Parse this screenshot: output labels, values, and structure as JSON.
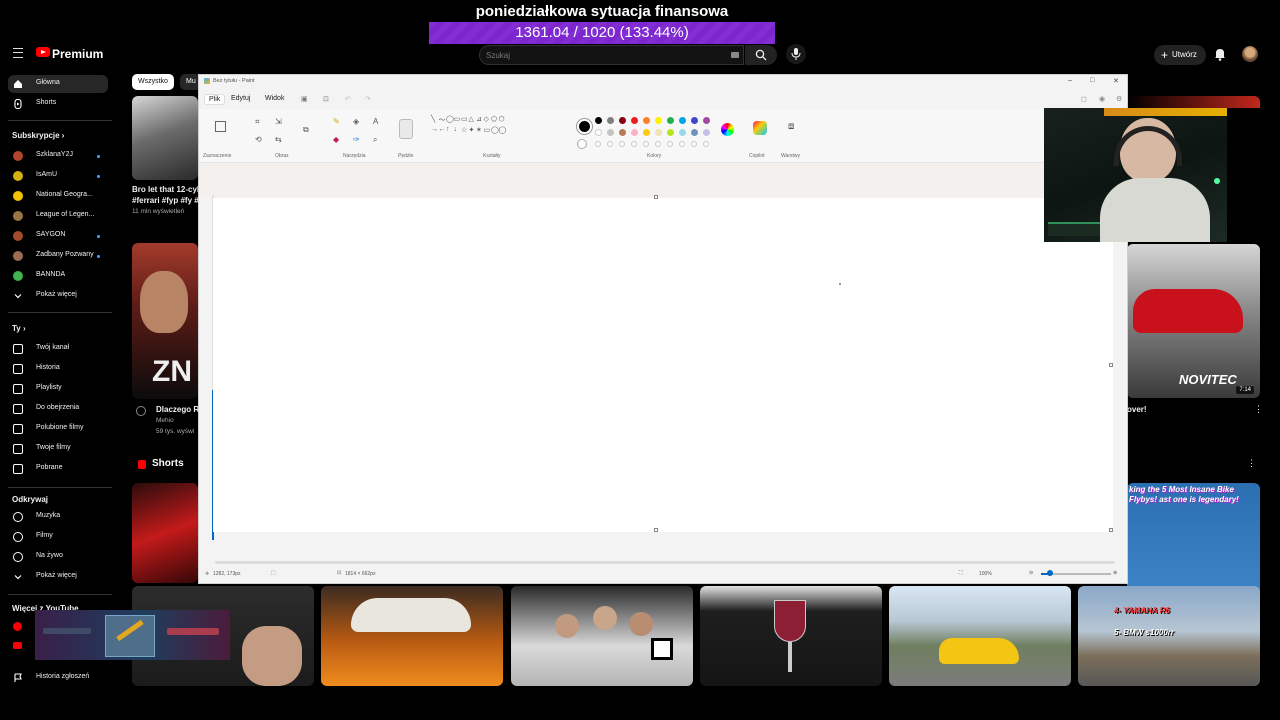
{
  "stream": {
    "title": "poniedziałkowa sytuacja finansowa",
    "progress_text": "1361.04 / 1020 (133.44%)",
    "progress_fraction": 1.0,
    "accent": "#8b2be2"
  },
  "youtube": {
    "brand": "Premium",
    "search_placeholder": "Szukaj",
    "create_label": "Utwórz",
    "chips": [
      "Wszystko",
      "Mu"
    ],
    "sidebar": {
      "main": [
        {
          "label": "Główna",
          "icon": "home-icon"
        },
        {
          "label": "Shorts",
          "icon": "shorts-icon"
        }
      ],
      "subs_header": "Subskrypcje",
      "subs": [
        {
          "label": "SzklanaY2J",
          "color": "#b0462d"
        },
        {
          "label": "IsAmU",
          "color": "#d4b012"
        },
        {
          "label": "National Geogra...",
          "color": "#f2c200"
        },
        {
          "label": "League of Legen...",
          "color": "#9a7740"
        },
        {
          "label": "SAYGON",
          "color": "#a34b2c"
        },
        {
          "label": "Zadbany Pozwany",
          "color": "#9c6b52"
        },
        {
          "label": "BANNDA",
          "color": "#3fb34f"
        }
      ],
      "show_more": "Pokaż więcej",
      "you_header": "Ty",
      "you": [
        {
          "label": "Twój kanał",
          "icon": "channel-icon"
        },
        {
          "label": "Historia",
          "icon": "history-icon"
        },
        {
          "label": "Playlisty",
          "icon": "playlist-icon"
        },
        {
          "label": "Do obejrzenia",
          "icon": "clock-icon"
        },
        {
          "label": "Polubione filmy",
          "icon": "like-icon"
        },
        {
          "label": "Twoje filmy",
          "icon": "video-icon"
        },
        {
          "label": "Pobrane",
          "icon": "download-icon"
        }
      ],
      "explore_header": "Odkrywaj",
      "explore": [
        {
          "label": "Muzyka",
          "icon": "music-icon"
        },
        {
          "label": "Filmy",
          "icon": "film-icon"
        },
        {
          "label": "Na żywo",
          "icon": "live-icon"
        }
      ],
      "show_more_2": "Pokaż więcej",
      "more_header": "Więcej z YouTube",
      "report": "Historia zgłoszeń"
    },
    "videos": [
      {
        "title": "Bro let that 12-cyli",
        "title2": "#ferrari #fyp #fy #",
        "meta": "11 mln wyświetleń"
      },
      {
        "title": "Dlaczego Ri",
        "channel": "Mehio",
        "meta": "59 tys. wyświ"
      },
      {
        "title": "over!"
      }
    ],
    "shorts_header": "Shorts",
    "right_thumb_text": "NOVITEC",
    "right_thumb_time": "7:14",
    "right_short_text": "king the 5 Most Insane Bike Flybys! ast one is legendary!",
    "bottom_short": {
      "line1": "4- YAMAHA R6",
      "line2": "5- BMW s1000rr"
    },
    "thumb_badge": "ZN"
  },
  "paint": {
    "window_title": "Bez tytułu - Paint",
    "menu": [
      "Plik",
      "Edytuj",
      "Widok"
    ],
    "groups": [
      "Zaznaczenie",
      "Obraz",
      "Narzędzia",
      "Pędzle",
      "Kształty",
      "Kolory",
      "Copilot",
      "Warstwy"
    ],
    "colors_row1": [
      "#000000",
      "#7f7f7f",
      "#880015",
      "#ed1c24",
      "#ff7f27",
      "#fff200",
      "#22b14c",
      "#00a2e8",
      "#3f48cc",
      "#a349a4"
    ],
    "colors_row2": [
      "#ffffff",
      "#c3c3c3",
      "#b97a57",
      "#ffaec9",
      "#ffc90e",
      "#efe4b0",
      "#b5e61d",
      "#99d9ea",
      "#7092be",
      "#c8bfe7"
    ],
    "status_cursor": "1282, 173px",
    "status_size": "1814 × 662px",
    "zoom": "100%"
  }
}
